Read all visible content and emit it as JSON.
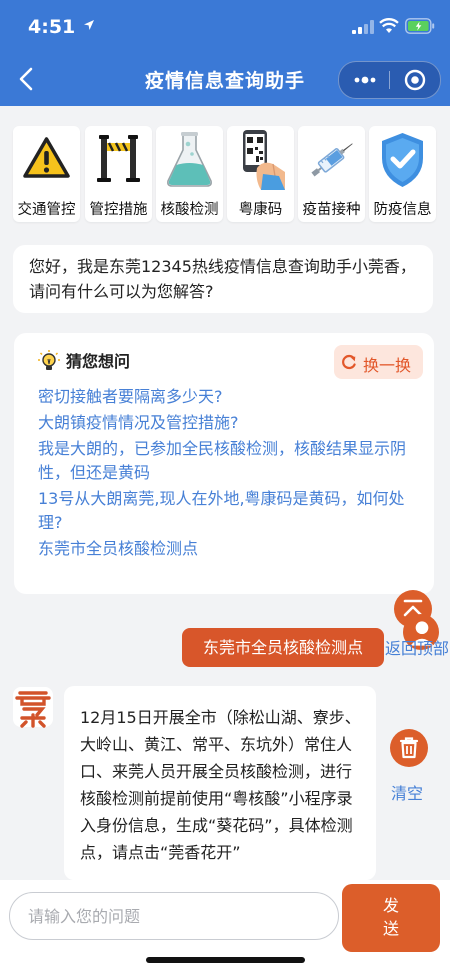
{
  "status_bar": {
    "time": "4:51"
  },
  "nav": {
    "title": "疫情信息查询助手"
  },
  "shortcuts": [
    {
      "label": "交通管控",
      "icon": "warning-sign-icon"
    },
    {
      "label": "管控措施",
      "icon": "barrier-icon"
    },
    {
      "label": "核酸检测",
      "icon": "flask-icon"
    },
    {
      "label": "粤康码",
      "icon": "qr-phone-icon"
    },
    {
      "label": "疫苗接种",
      "icon": "syringe-icon"
    },
    {
      "label": "防疫信息",
      "icon": "shield-check-icon"
    }
  ],
  "greeting": "您好，我是东莞12345热线疫情信息查询助手小莞香，请问有什么可以为您解答?",
  "guess": {
    "title": "猜您想问",
    "swap_label": "换一换",
    "questions": [
      "密切接触者要隔离多少天?",
      "大朗镇疫情情况及管控措施?",
      "我是大朗的，已参加全民核酸检测，核酸结果显示阴性，但还是黄码",
      "13号从大朗离莞,现人在外地,粤康码是黄码，如何处理?",
      "东莞市全员核酸检测点"
    ]
  },
  "floating": {
    "back_top_label": "返回顶部",
    "clear_label": "清空"
  },
  "chat": {
    "user_message": "东莞市全员核酸检测点",
    "bot_message": "12月15日开展全市（除松山湖、寮步、大岭山、黄江、常平、东坑外）常住人口、来莞人员开展全员核酸检测，进行核酸检测前提前使用“粤核酸”小程序录入身份信息，生成“葵花码”，具体检测点，请点击“莞香花开”"
  },
  "input": {
    "placeholder": "请输入您的问题",
    "send_label": "发送"
  },
  "colors": {
    "header": "#3b79d6",
    "accent": "#dc5e2a",
    "link": "#4780d6"
  }
}
